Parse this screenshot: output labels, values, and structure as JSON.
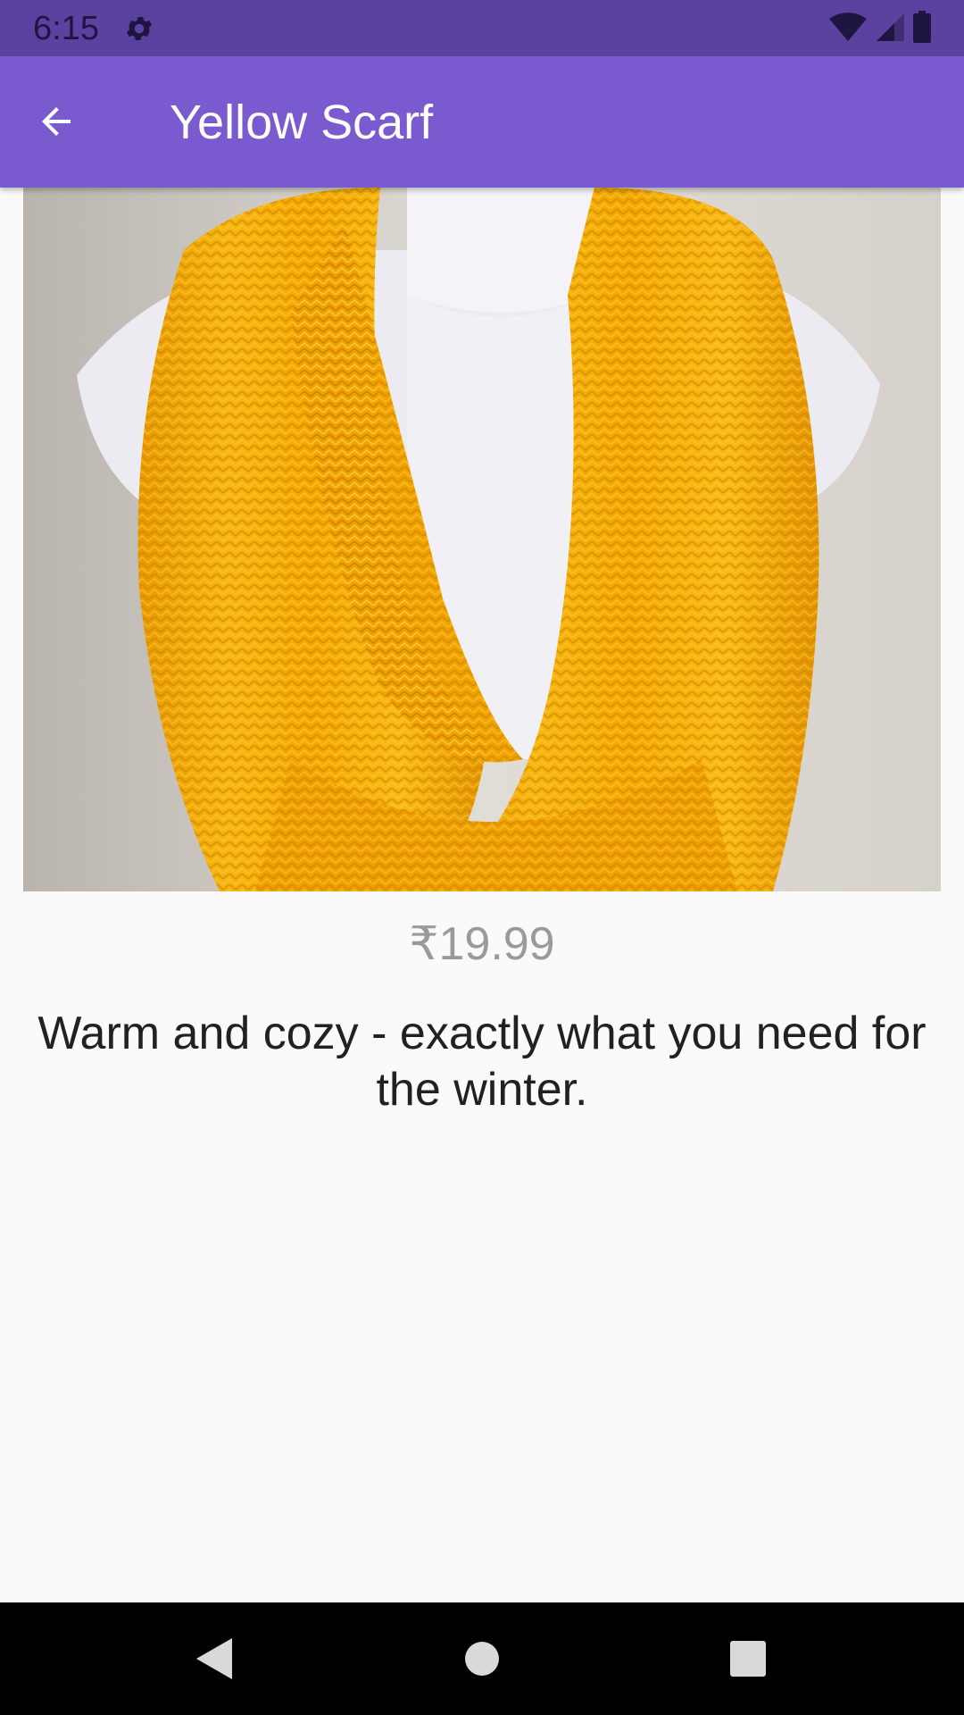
{
  "status_bar": {
    "time": "6:15",
    "icons": [
      "settings-gear-icon",
      "wifi-icon",
      "signal-icon",
      "battery-icon"
    ]
  },
  "app_bar": {
    "title": "Yellow Scarf",
    "back_icon": "arrow-back-icon",
    "color": "#7a5bcf"
  },
  "product": {
    "image": "yellow knitted infinity scarf on white mannequin",
    "price": "₹19.99",
    "description": "Warm and cozy - exactly what you need for the winter."
  },
  "nav_bar": {
    "buttons": [
      "back-triangle-icon",
      "home-circle-icon",
      "recents-square-icon"
    ]
  }
}
